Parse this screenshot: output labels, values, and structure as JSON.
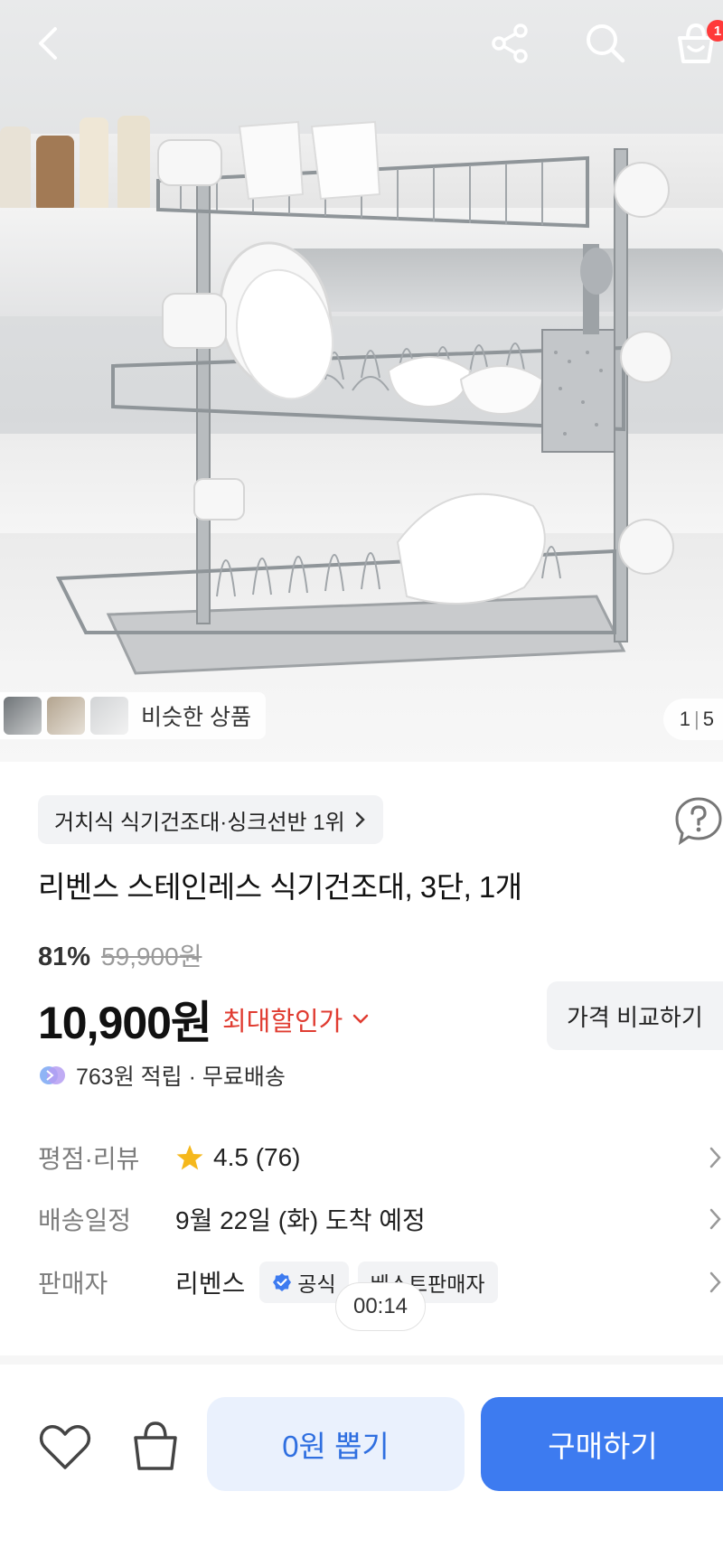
{
  "cart": {
    "badge": "1"
  },
  "gallery": {
    "similar_label": "비슷한 상품",
    "counter_current": "1",
    "counter_sep": "|",
    "counter_total": "5"
  },
  "product": {
    "category": "거치식 식기건조대·싱크선반 1위",
    "title": "리벤스 스테인레스 식기건조대, 3단, 1개",
    "discount_pct": "81%",
    "original_price": "59,900원",
    "price": "10,900원",
    "max_discount_label": "최대할인가",
    "compare_label": "가격 비교하기",
    "points_text": "763원 적립 · 무료배송"
  },
  "details": {
    "rating_label": "평점·리뷰",
    "rating_value": "4.5 (76)",
    "shipping_label": "배송일정",
    "shipping_value": "9월 22일 (화) 도착 예정",
    "seller_label": "판매자",
    "seller_name": "리벤스",
    "official_badge": "공식",
    "best_seller_badge": "베스트판매자"
  },
  "timer": "00:14",
  "bottom_bar": {
    "draw_label": "0원 뽑기",
    "buy_label": "구매하기"
  },
  "colors": {
    "accent_blue": "#3d7bf0",
    "discount_red": "#e03c31",
    "badge_red": "#ff3a3a",
    "star": "#f5b81c"
  }
}
